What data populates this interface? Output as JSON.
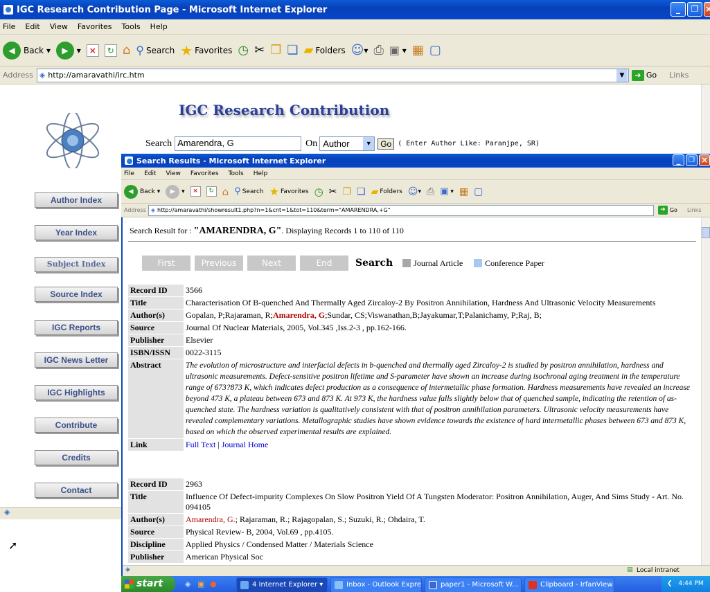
{
  "outer": {
    "title": "IGC Research Contribution Page - Microsoft Internet Explorer",
    "menu": [
      "File",
      "Edit",
      "View",
      "Favorites",
      "Tools",
      "Help"
    ],
    "toolbar": {
      "back": "Back",
      "search": "Search",
      "favorites": "Favorites",
      "folders": "Folders"
    },
    "address_label": "Address",
    "address": "http://amaravathi/irc.htm",
    "go": "Go",
    "links": "Links"
  },
  "page": {
    "heading": "IGC Research Contribution",
    "search_label": "Search",
    "search_value": "Amarendra, G",
    "on_label": "On",
    "field_selected": "Author",
    "go_btn": "Go",
    "hint": "( Enter Author Like:  Paranjpe, SR)"
  },
  "nav": [
    "Author Index",
    "Year Index",
    "Subject Index",
    "Source Index",
    "IGC Reports",
    "IGC News Letter",
    "IGC Highlights",
    "Contribute",
    "Credits",
    "Contact"
  ],
  "inner": {
    "title": "Search Results - Microsoft Internet Explorer",
    "menu": [
      "File",
      "Edit",
      "View",
      "Favorites",
      "Tools",
      "Help"
    ],
    "toolbar": {
      "back": "Back",
      "search": "Search",
      "favorites": "Favorites",
      "folders": "Folders"
    },
    "address_label": "Address",
    "address": "http://amaravathi/showresult1.php?n=1&cnt=1&tot=110&term=\"AMARENDRA,+G\"",
    "go": "Go",
    "links": "Links",
    "result_prefix": "Search Result for : ",
    "result_term": "\"AMARENDRA, G\"",
    "result_suffix": ". Displaying Records 1 to 110 of 110",
    "nav_buttons": [
      "First",
      "Previous",
      "Next",
      "End"
    ],
    "search_logo": "Search",
    "legend": [
      {
        "label": "Journal Article",
        "color": "#a8a8a8"
      },
      {
        "label": "Conference Paper",
        "color": "#a8c8f0"
      }
    ],
    "status": "Local intranet"
  },
  "records": [
    {
      "record_id": "3566",
      "title": "Characterisation Of B-quenched And Thermally Aged Zircaloy-2 By Positron Annihilation, Hardness And Ultrasonic Velocity Measurements",
      "authors_pre": "Gopalan, P;Rajaraman, R;",
      "authors_hl": "Amarendra, G",
      "authors_post": ";Sundar, CS;Viswanathan,B;Jayakumar,T;Palanichamy, P;Raj, B;",
      "source": "Journal Of Nuclear Materials, 2005, Vol.345 ,Iss.2-3 , pp.162-166.",
      "publisher": "Elsevier",
      "isbn": "0022-3115",
      "abstract": "The evolution of microstructure and interfacial defects in b-quenched and thermally aged Zircaloy-2 is studied by positron annihilation, hardness and ultrasonic measurements. Defect-sensitive positron lifetime and S-parameter have shown an increase during isochronal aging treatment in the temperature range of 673?873 K, which indicates defect production as a consequence of intermetallic phase formation. Hardness measurements have revealed an increase beyond 473 K, a plateau between 673 and 873 K. At 973 K, the hardness value falls slightly below that of quenched sample, indicating the retention of as-quenched state. The hardness variation is qualitatively consistent with that of positron annihilation parameters. Ultrasonic velocity measurements have revealed complementary variations. Metallographic studies have shown evidence towards the existence of hard intermetallic phases between 673 and 873 K, based on which the observed experimental results are explained.",
      "link1": "Full Text",
      "link_sep": " | ",
      "link2": "Journal Home"
    },
    {
      "record_id": "2963",
      "title": "Influence Of Defect-impurity Complexes On Slow Positron Yield Of A Tungsten Moderator: Positron Annihilation, Auger, And Sims Study - Art. No. 094105",
      "authors_pre": "",
      "authors_hl": "Amarendra, G.",
      "authors_post": "; Rajaraman, R.; Rajagopalan, S.; Suzuki, R.; Ohdaira, T.",
      "source": "Physical Review- B, 2004, Vol.69 , pp.4105.",
      "discipline": "Applied Physics / Condensed Matter / Materials Science",
      "publisher": "American Physical Soc"
    }
  ],
  "labels": {
    "record_id": "Record ID",
    "title": "Title",
    "authors": "Author(s)",
    "source": "Source",
    "publisher": "Publisher",
    "isbn": "ISBN/ISSN",
    "abstract": "Abstract",
    "link": "Link",
    "discipline": "Discipline"
  },
  "taskbar": {
    "start": "start",
    "items": [
      "4 Internet Explorer",
      "Inbox - Outlook Express",
      "paper1 - Microsoft W...",
      "Clipboard - IrfanView"
    ],
    "clock": "4:44 PM"
  }
}
